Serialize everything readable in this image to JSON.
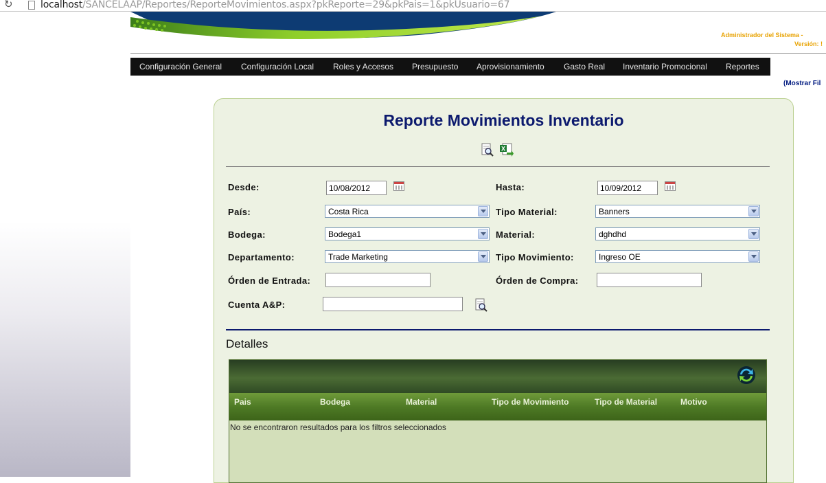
{
  "browser": {
    "url_host": "localhost",
    "url_path": "/SANCELAAP/Reportes/ReporteMovimientos.aspx?pkReporte=29&pkPais=1&pkUsuario=67"
  },
  "header": {
    "admin_text": "Administrador del Sistema -",
    "version_text": "Versión: !"
  },
  "menu": {
    "items": [
      "Configuración General",
      "Configuración Local",
      "Roles y Accesos",
      "Presupuesto",
      "Aprovisionamiento",
      "Gasto Real",
      "Inventario Promocional",
      "Reportes"
    ]
  },
  "filters_toggle": "(Mostrar Fil",
  "report": {
    "title": "Reporte Movimientos Inventario",
    "icons": [
      "magnifier-document-icon",
      "excel-export-icon"
    ],
    "fields": {
      "desde_label": "Desde:",
      "desde_value": "10/08/2012",
      "hasta_label": "Hasta:",
      "hasta_value": "10/09/2012",
      "pais_label": "País:",
      "pais_value": "Costa Rica",
      "tipo_material_label": "Tipo Material:",
      "tipo_material_value": "Banners",
      "bodega_label": "Bodega:",
      "bodega_value": "Bodega1",
      "material_label": "Material:",
      "material_value": "dghdhd",
      "departamento_label": "Departamento:",
      "departamento_value": "Trade Marketing",
      "tipo_movimiento_label": "Tipo Movimiento:",
      "tipo_movimiento_value": "Ingreso OE",
      "orden_entrada_label": "Órden de Entrada:",
      "orden_entrada_value": "",
      "orden_compra_label": "Órden de Compra:",
      "orden_compra_value": "",
      "cuenta_label": "Cuenta A&P:",
      "cuenta_value": ""
    },
    "details_heading": "Detalles",
    "grid": {
      "columns": [
        "Pais",
        "Bodega",
        "Material",
        "Tipo de Movimiento",
        "Tipo de Material",
        "Motivo"
      ],
      "empty_message": "No se encontraron resultados para los filtros seleccionados"
    }
  },
  "colors": {
    "menu_bg": "#111111",
    "title_color": "#0c1a6e",
    "panel_bg": "#edf2e3",
    "grid_header": "#4e7a25",
    "admin_color": "#e8a200"
  }
}
